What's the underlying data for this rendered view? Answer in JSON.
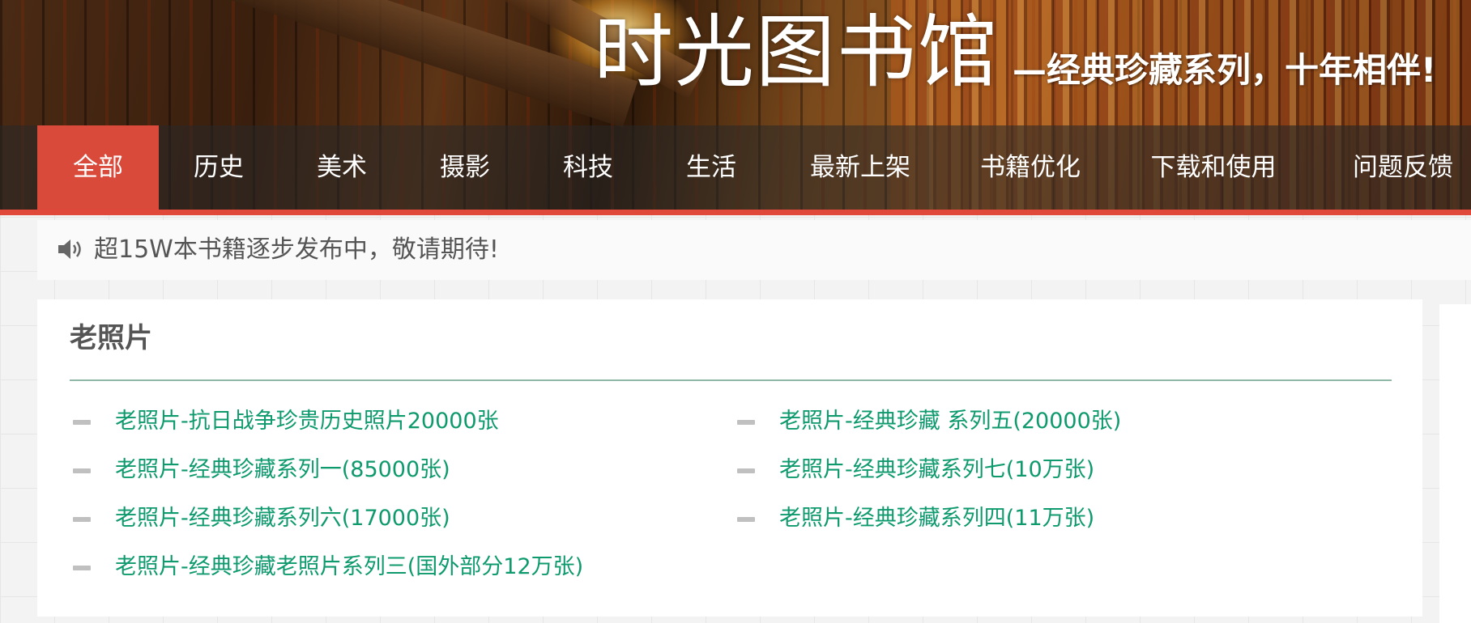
{
  "header": {
    "title": "时光图书馆",
    "subtitle": "—经典珍藏系列，十年相伴!"
  },
  "nav": {
    "items": [
      {
        "label": "全部",
        "active": true
      },
      {
        "label": "历史"
      },
      {
        "label": "美术"
      },
      {
        "label": "摄影"
      },
      {
        "label": "科技"
      },
      {
        "label": "生活"
      },
      {
        "label": "最新上架"
      },
      {
        "label": "书籍优化"
      },
      {
        "label": "下载和使用"
      },
      {
        "label": "问题反馈"
      }
    ],
    "active_color": "#d94a3a"
  },
  "notice": {
    "icon": "speaker-icon",
    "text": "超15W本书籍逐步发布中，敬请期待!"
  },
  "section": {
    "title": "老照片",
    "link_color": "#0f9a6e",
    "items_left": [
      "老照片-抗日战争珍贵历史照片20000张",
      "老照片-经典珍藏系列一(85000张)",
      "老照片-经典珍藏系列六(17000张)",
      "老照片-经典珍藏老照片系列三(国外部分12万张)"
    ],
    "items_right": [
      "老照片-经典珍藏 系列五(20000张)",
      "老照片-经典珍藏系列七(10万张)",
      "老照片-经典珍藏系列四(11万张)"
    ]
  }
}
